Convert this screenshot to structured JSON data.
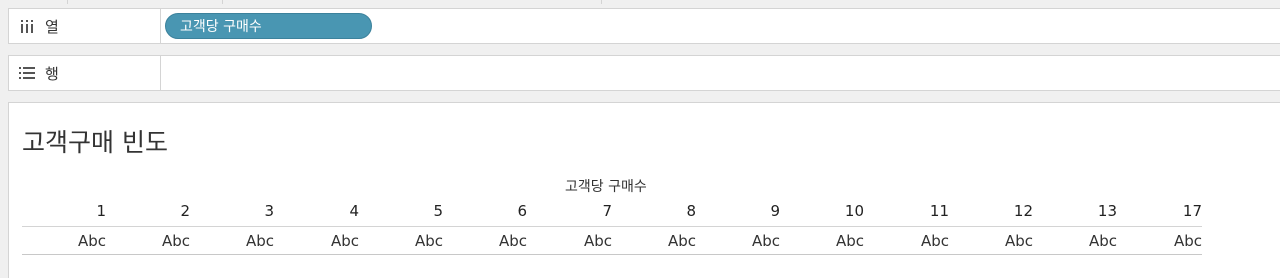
{
  "columns_shelf": {
    "label": "열",
    "pill": "고객당 구매수"
  },
  "rows_shelf": {
    "label": "행"
  },
  "view": {
    "title": "고객구매 빈도",
    "column_field_header": "고객당 구매수",
    "headers": [
      "1",
      "2",
      "3",
      "4",
      "5",
      "6",
      "7",
      "8",
      "9",
      "10",
      "11",
      "12",
      "13",
      "17"
    ],
    "cells": [
      "Abc",
      "Abc",
      "Abc",
      "Abc",
      "Abc",
      "Abc",
      "Abc",
      "Abc",
      "Abc",
      "Abc",
      "Abc",
      "Abc",
      "Abc",
      "Abc"
    ]
  },
  "icons": {
    "columns": "columns-icon",
    "rows": "rows-icon"
  },
  "colors": {
    "pill": "#4996b2",
    "border": "#d4d4d4",
    "background": "#f0f0f0"
  }
}
